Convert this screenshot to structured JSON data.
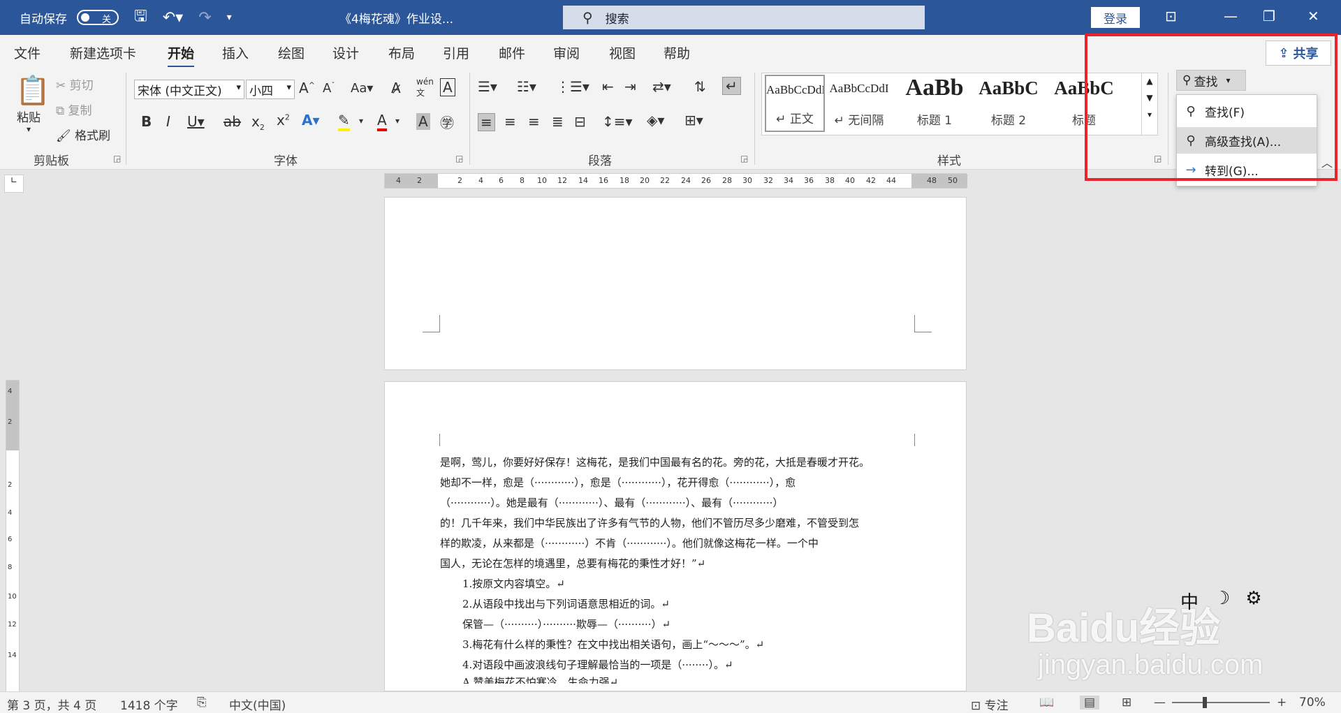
{
  "titlebar": {
    "autosave_label": "自动保存",
    "autosave_state": "关",
    "doc_title": "《4梅花魂》作业设...",
    "search_placeholder": "搜索",
    "login": "登录"
  },
  "tabs": [
    "文件",
    "新建选项卡",
    "开始",
    "插入",
    "绘图",
    "设计",
    "布局",
    "引用",
    "邮件",
    "审阅",
    "视图",
    "帮助"
  ],
  "active_tab": "开始",
  "share": "共享",
  "clipboard": {
    "paste": "粘贴",
    "cut": "剪切",
    "copy": "复制",
    "format_painter": "格式刷",
    "label": "剪贴板"
  },
  "font": {
    "name": "宋体 (中文正文)",
    "size": "小四",
    "label": "字体"
  },
  "paragraph": {
    "label": "段落"
  },
  "styles": {
    "label": "样式",
    "items": [
      {
        "sample": "AaBbCcDdI",
        "name": "↵ 正文"
      },
      {
        "sample": "AaBbCcDdI",
        "name": "↵ 无间隔"
      },
      {
        "sample": "AaBb",
        "name": "标题 1"
      },
      {
        "sample": "AaBbC",
        "name": "标题 2"
      },
      {
        "sample": "AaBbC",
        "name": "标题"
      }
    ]
  },
  "editing": {
    "find_button": "查找",
    "menu": [
      {
        "label": "查找(F)",
        "icon": "search-icon"
      },
      {
        "label": "高级查找(A)...",
        "icon": "search-icon"
      },
      {
        "label": "转到(G)...",
        "icon": "arrow-right-icon"
      }
    ]
  },
  "ruler": {
    "h": [
      "4",
      "2",
      "2",
      "4",
      "6",
      "8",
      "10",
      "12",
      "14",
      "16",
      "18",
      "20",
      "22",
      "24",
      "26",
      "28",
      "30",
      "32",
      "34",
      "36",
      "38",
      "40",
      "42",
      "44",
      "48",
      "50"
    ],
    "v": [
      "4",
      "2",
      "2",
      "4",
      "6",
      "8",
      "10",
      "12",
      "14"
    ]
  },
  "document": {
    "lines": [
      {
        "text": "是啊，莺儿，你要好好保存！这梅花，是我们中国最有名的花。旁的花，大抵是春暖才开花。",
        "indent": false
      },
      {
        "text": "她却不一样，愈是（············），愈是（············），花开得愈（············），愈",
        "indent": false
      },
      {
        "text": "（············）。她是最有（············）、最有（············）、最有（············）",
        "indent": false
      },
      {
        "text": "的！几千年来，我们中华民族出了许多有气节的人物，他们不管历尽多少磨难，不管受到怎",
        "indent": false
      },
      {
        "text": "样的欺凌，从来都是（············）不肯（············）。他们就像这梅花一样。一个中",
        "indent": false
      },
      {
        "text": "国人，无论在怎样的境遇里，总要有梅花的秉性才好！”↵",
        "indent": false
      },
      {
        "text": "1.按原文内容填空。↵",
        "indent": true
      },
      {
        "text": "2.从语段中找出与下列词语意思相近的词。↵",
        "indent": true
      },
      {
        "text": "保管—（··········）··········欺辱—（··········）↵",
        "indent": true
      },
      {
        "text": "3.梅花有什么样的秉性？在文中找出相关语句，画上“～～～”。↵",
        "indent": true
      },
      {
        "text": "4.对语段中画波浪线句子理解最恰当的一项是（········）。↵",
        "indent": true
      },
      {
        "text": "A.赞美梅花不怕寒冷，生命力强↵",
        "indent": true
      }
    ]
  },
  "status": {
    "page": "第 3 页，共 4 页",
    "words": "1418 个字",
    "language": "中文(中国)",
    "focus": "专注",
    "zoom": "70%"
  },
  "watermark": {
    "brand": "Baidu经验",
    "url": "jingyan.baidu.com"
  },
  "ime": [
    "中",
    "☽",
    "⚙"
  ],
  "colors": {
    "titlebar": "#2b579a",
    "highlight_box": "#e8242c"
  }
}
